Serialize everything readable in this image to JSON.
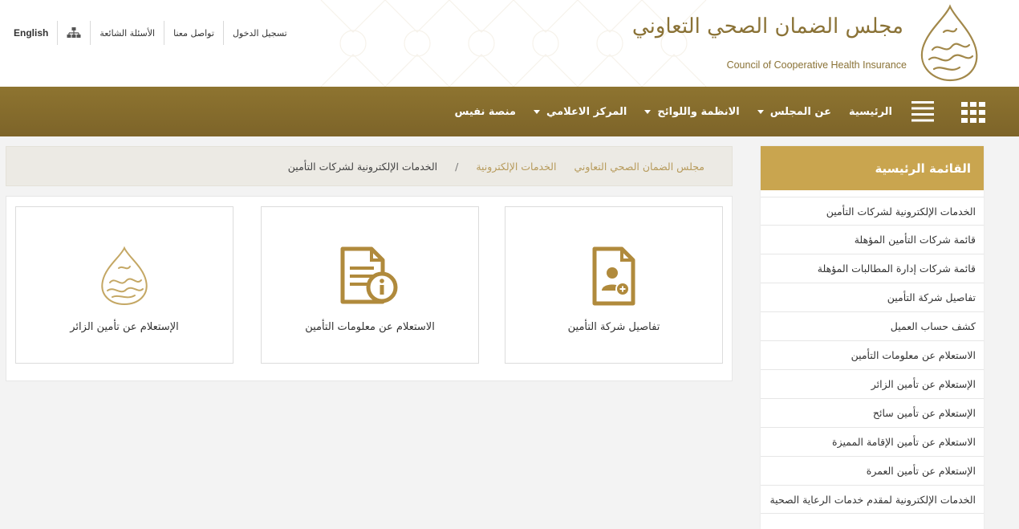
{
  "header": {
    "top_links": [
      {
        "label": "English"
      },
      {
        "label": ""
      },
      {
        "label": "الأسئلة الشائعة"
      },
      {
        "label": "تواصل معنا"
      },
      {
        "label": "تسجيل الدخول"
      }
    ],
    "logo_arabic": "مجلس الضمان الصحي التعاوني",
    "logo_english": "Council of Cooperative Health Insurance"
  },
  "nav": {
    "items": [
      {
        "label": "الرئيسية",
        "has_caret": false
      },
      {
        "label": "عن المجلس",
        "has_caret": true
      },
      {
        "label": "الانظمة واللوائح",
        "has_caret": true
      },
      {
        "label": "المركز الاعلامي",
        "has_caret": true
      },
      {
        "label": "منصة نفيس",
        "has_caret": false
      }
    ]
  },
  "breadcrumb": {
    "items": [
      "مجلس الضمان الصحي التعاوني",
      "الخدمات الإلكترونية"
    ],
    "separator": "/",
    "current": "الخدمات الإلكترونية لشركات التأمين"
  },
  "sidebar": {
    "title": "القائمة الرئيسية",
    "items": [
      "الخدمات الإلكترونية لشركات التأمين",
      "قائمة شركات التأمين المؤهلة",
      "قائمة شركات إدارة المطالبات المؤهلة",
      "تفاصيل شركة التأمين",
      "كشف حساب العميل",
      "الاستعلام عن معلومات التأمين",
      "الإستعلام عن تأمين الزائر",
      "الإستعلام عن تأمين سائح",
      "الاستعلام عن تأمين الإقامة المميزة",
      "الإستعلام عن تأمين العمرة",
      "الخدمات الإلكترونية لمقدم خدمات الرعاية الصحية"
    ]
  },
  "cards": [
    {
      "label": "تفاصيل شركة التأمين",
      "icon": "document-user-icon"
    },
    {
      "label": "الاستعلام عن معلومات التأمين",
      "icon": "document-info-icon"
    },
    {
      "label": "الإستعلام عن تأمين الزائر",
      "icon": "council-emblem-icon"
    }
  ],
  "colors": {
    "gold": "#8e7430",
    "gold_light": "#c9a54f",
    "breadcrumb_link": "#b79b5c"
  }
}
